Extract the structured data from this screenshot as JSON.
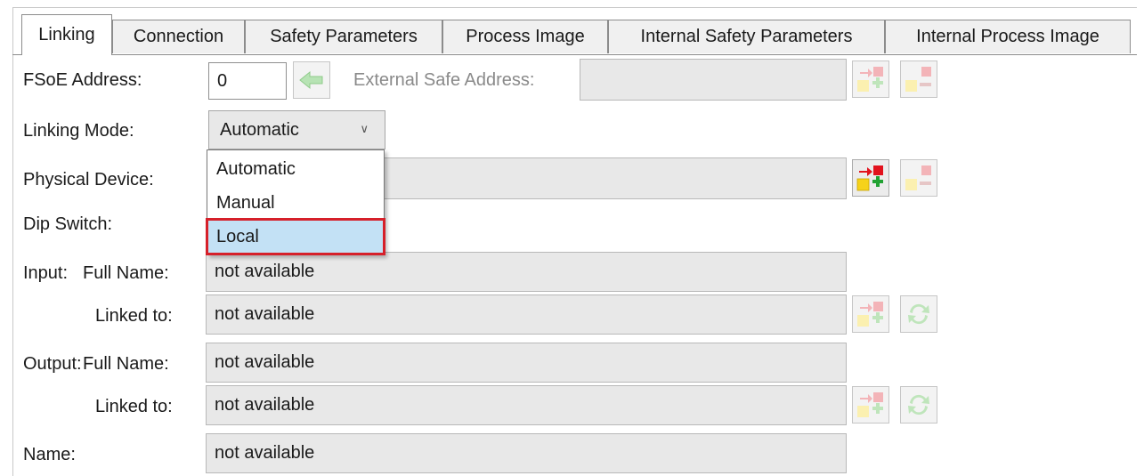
{
  "tabs": [
    {
      "label": "Linking",
      "active": true
    },
    {
      "label": "Connection"
    },
    {
      "label": "Safety Parameters"
    },
    {
      "label": "Process Image"
    },
    {
      "label": "Internal Safety Parameters"
    },
    {
      "label": "Internal Process Image"
    }
  ],
  "fsoe": {
    "label": "FSoE Address:",
    "value": "0",
    "external_label": "External Safe Address:",
    "external_value": ""
  },
  "linking_mode": {
    "label": "Linking Mode:",
    "selected": "Automatic",
    "options": [
      "Automatic",
      "Manual",
      "Local"
    ],
    "highlighted": "Local"
  },
  "physical_device": {
    "label": "Physical Device:",
    "value": ""
  },
  "dip_switch": {
    "label": "Dip Switch:"
  },
  "input": {
    "group_label": "Input:",
    "full_name_label": "Full Name:",
    "full_name_value": "not available",
    "linked_to_label": "Linked to:",
    "linked_to_value": "not available"
  },
  "output": {
    "group_label": "Output:",
    "full_name_label": "Full Name:",
    "full_name_value": "not available",
    "linked_to_label": "Linked to:",
    "linked_to_value": "not available"
  },
  "name": {
    "label": "Name:",
    "value": "not available"
  },
  "colors": {
    "selection_bg": "#c3e1f5",
    "selection_outline": "#d6202a",
    "field_bg": "#e8e8e8"
  }
}
